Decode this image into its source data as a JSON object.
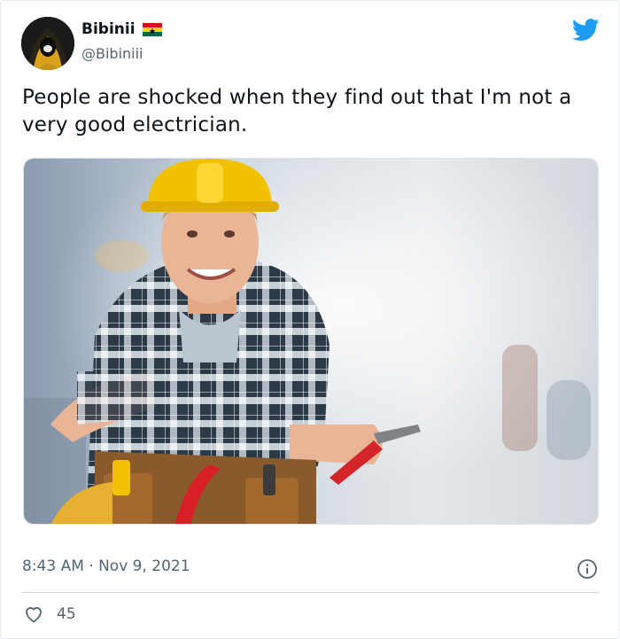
{
  "user": {
    "display_name": "Bibinii",
    "handle": "@Bibiniii",
    "flag_icon": "ghana-flag-icon"
  },
  "tweet": {
    "text": "People are shocked when they find out that I'm not a very good electrician.",
    "timestamp": "8:43 AM · Nov 9, 2021",
    "likes": "45"
  },
  "colors": {
    "twitter_blue": "#1d9bf0",
    "secondary_text": "#536471",
    "divider": "#cfd9de"
  },
  "icons": {
    "brand": "twitter-bird-icon",
    "info": "info-icon",
    "like": "heart-icon"
  }
}
